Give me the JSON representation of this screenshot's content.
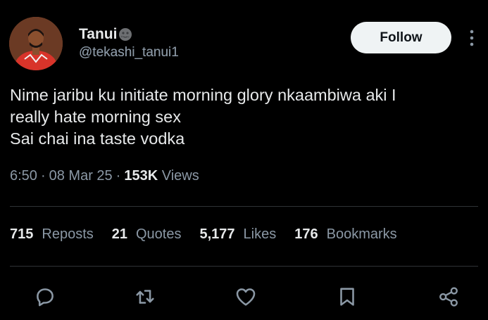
{
  "author": {
    "display_name": "Tanui",
    "handle": "@tekashi_tanui1",
    "badge_icon": "new-moon-face-emoji-icon",
    "avatar_icon": "user-avatar"
  },
  "follow_button": {
    "label": "Follow"
  },
  "more_icon": "more-vertical-icon",
  "tweet": {
    "lines": [
      "Nime jaribu ku initiate morning glory nkaambiwa aki I",
      "really hate morning sex",
      "Sai chai ina taste vodka"
    ]
  },
  "meta": {
    "time": "6:50",
    "date": "08 Mar 25",
    "views_count": "153K",
    "views_label": "Views",
    "separator": "·"
  },
  "stats": {
    "reposts": {
      "count": "715",
      "label": "Reposts"
    },
    "quotes": {
      "count": "21",
      "label": "Quotes"
    },
    "likes": {
      "count": "5,177",
      "label": "Likes"
    },
    "bookmarks": {
      "count": "176",
      "label": "Bookmarks"
    }
  },
  "actions": [
    "reply-icon",
    "repost-icon",
    "like-icon",
    "bookmark-icon",
    "share-icon"
  ],
  "colors": {
    "background": "#000000",
    "primary_text": "#e7e9ea",
    "secondary_text": "#8b98a5",
    "divider": "#2f3336",
    "button_bg": "#eff3f4"
  }
}
